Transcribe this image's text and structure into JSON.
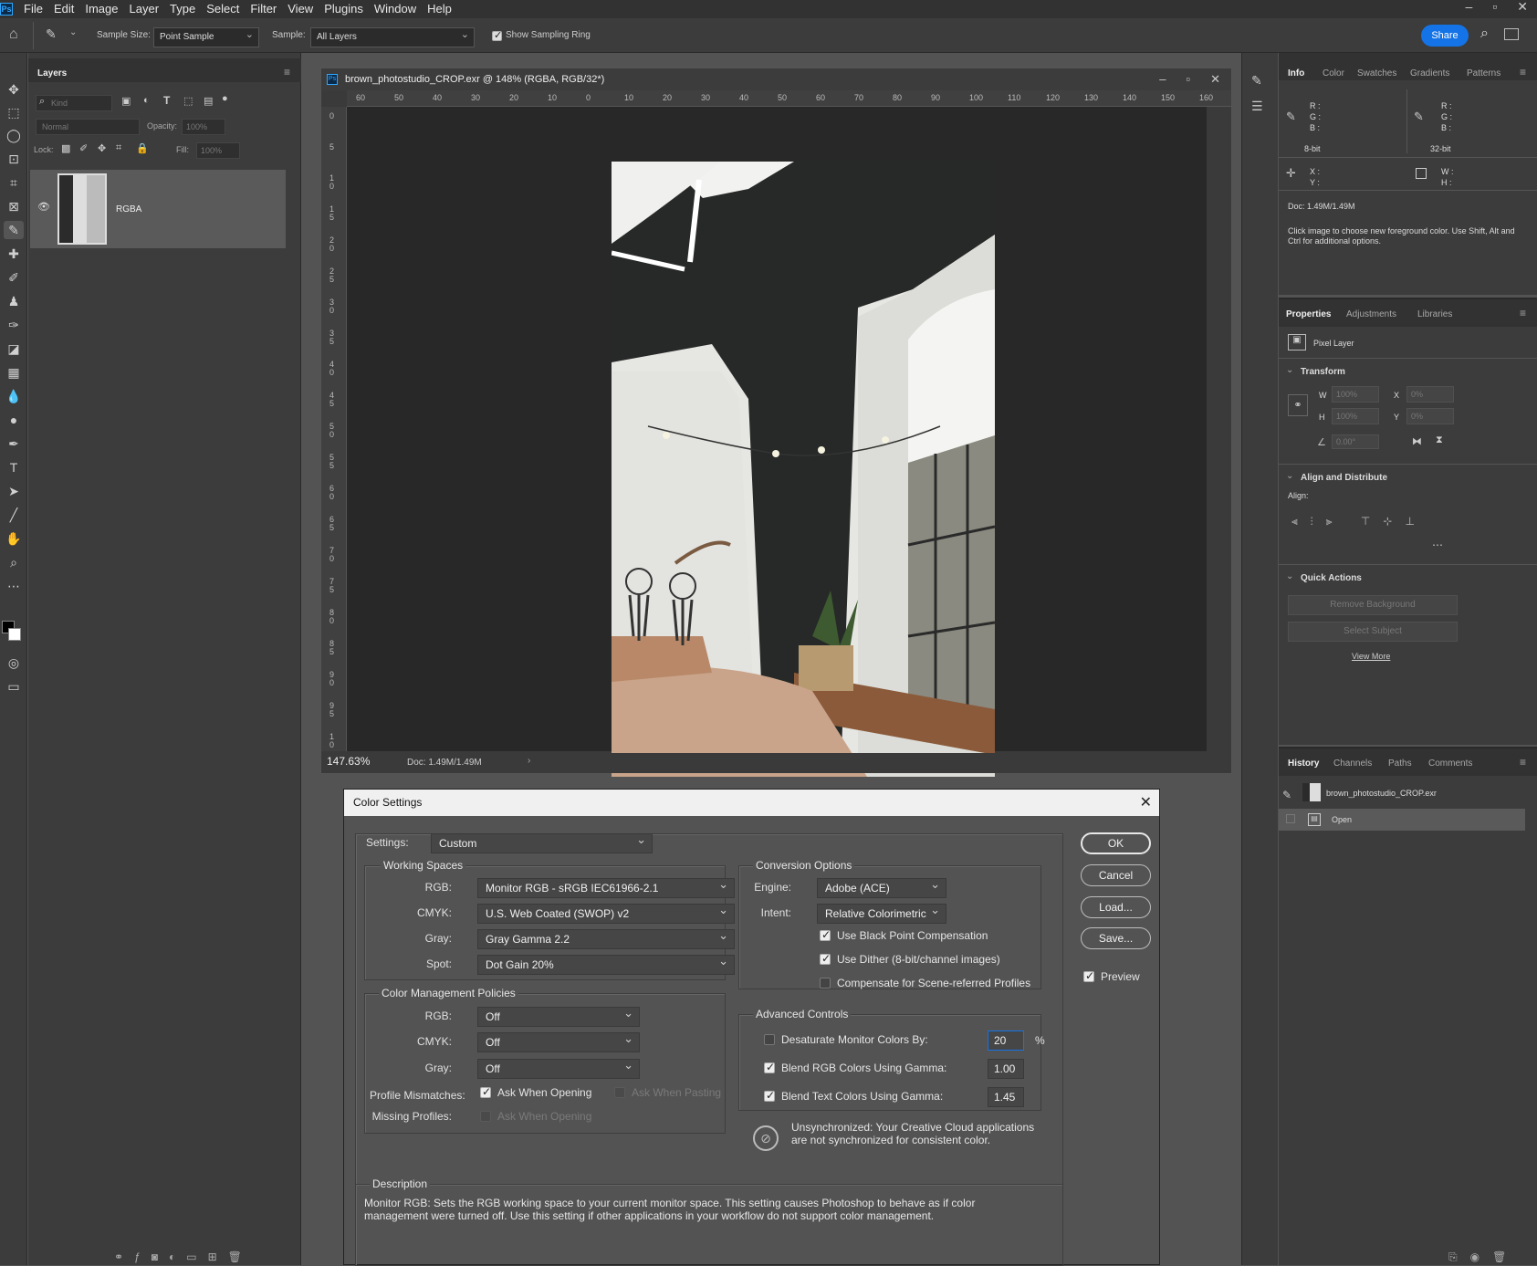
{
  "app": {
    "logo": "Ps"
  },
  "menu": [
    "File",
    "Edit",
    "Image",
    "Layer",
    "Type",
    "Select",
    "Filter",
    "View",
    "Plugins",
    "Window",
    "Help"
  ],
  "options": {
    "sample_size_label": "Sample Size:",
    "sample_size_value": "Point Sample",
    "sample_label": "Sample:",
    "sample_value": "All Layers",
    "show_ring_label": "Show Sampling Ring",
    "share_label": "Share"
  },
  "layers_panel": {
    "tab": "Layers",
    "kind": "Kind",
    "blend": "Normal",
    "opacity_label": "Opacity:",
    "opacity_value": "100%",
    "lock_label": "Lock:",
    "fill_label": "Fill:",
    "fill_value": "100%",
    "layer_name": "RGBA"
  },
  "document": {
    "title": "brown_photostudio_CROP.exr @ 148% (RGBA, RGB/32*)",
    "zoom": "147.63%",
    "doc_size": "Doc: 1.49M/1.49M",
    "h_ticks": [
      "60",
      "50",
      "40",
      "30",
      "20",
      "10",
      "0",
      "10",
      "20",
      "30",
      "40",
      "50",
      "60",
      "70",
      "80",
      "90",
      "100",
      "110",
      "120",
      "130",
      "140",
      "150",
      "160"
    ],
    "v_ticks": [
      "0",
      "5",
      "1 0",
      "1 5",
      "2 0",
      "2 5",
      "3 0",
      "3 5",
      "4 0",
      "4 5",
      "5 0",
      "5 5",
      "6 0",
      "6 5",
      "7 0",
      "7 5",
      "8 0",
      "8 5",
      "9 0",
      "9 5",
      "1 0"
    ]
  },
  "info_panel": {
    "tabs": [
      "Info",
      "Color",
      "Swatches",
      "Gradients",
      "Patterns"
    ],
    "rgb_labels": "R :\nG :\nB :",
    "bit8": "8-bit",
    "bit32": "32-bit",
    "xy": "X :\nY :",
    "wh": "W :\nH :",
    "doc": "Doc: 1.49M/1.49M",
    "hint": "Click image to choose new foreground color.  Use Shift, Alt and Ctrl for additional options."
  },
  "properties_panel": {
    "tabs": [
      "Properties",
      "Adjustments",
      "Libraries"
    ],
    "pixel_layer": "Pixel Layer",
    "transform": "Transform",
    "w_label": "W",
    "w_value": "100%",
    "x_label": "X",
    "x_value": "0%",
    "h_label": "H",
    "h_value": "100%",
    "y_label": "Y",
    "y_value": "0%",
    "angle_value": "0.00°",
    "align_title": "Align and Distribute",
    "align_label": "Align:",
    "quick_title": "Quick Actions",
    "remove_bg": "Remove Background",
    "select_subject": "Select Subject",
    "view_more": "View More"
  },
  "history_panel": {
    "tabs": [
      "History",
      "Channels",
      "Paths",
      "Comments"
    ],
    "snapshot": "brown_photostudio_CROP.exr",
    "step": "Open"
  },
  "dialog": {
    "title": "Color Settings",
    "settings_label": "Settings:",
    "settings_value": "Custom",
    "working_spaces": "Working Spaces",
    "rgb_label": "RGB:",
    "rgb_value": "Monitor RGB - sRGB IEC61966-2.1",
    "cmyk_label": "CMYK:",
    "cmyk_value": "U.S. Web Coated (SWOP) v2",
    "gray_label": "Gray:",
    "gray_value": "Gray Gamma 2.2",
    "spot_label": "Spot:",
    "spot_value": "Dot Gain 20%",
    "policies": "Color Management Policies",
    "p_rgb_label": "RGB:",
    "p_rgb_value": "Off",
    "p_cmyk_label": "CMYK:",
    "p_cmyk_value": "Off",
    "p_gray_label": "Gray:",
    "p_gray_value": "Off",
    "mismatch_label": "Profile Mismatches:",
    "ask_opening": "Ask When Opening",
    "ask_pasting": "Ask When Pasting",
    "missing_label": "Missing Profiles:",
    "missing_ask": "Ask When Opening",
    "conversion": "Conversion Options",
    "engine_label": "Engine:",
    "engine_value": "Adobe (ACE)",
    "intent_label": "Intent:",
    "intent_value": "Relative Colorimetric",
    "bpc": "Use Black Point Compensation",
    "dither": "Use Dither (8-bit/channel images)",
    "scene": "Compensate for Scene-referred Profiles",
    "advanced": "Advanced Controls",
    "desaturate": "Desaturate Monitor Colors By:",
    "desat_value": "20",
    "percent": "%",
    "blend_rgb": "Blend RGB Colors Using Gamma:",
    "blend_rgb_value": "1.00",
    "blend_text": "Blend Text Colors Using Gamma:",
    "blend_text_value": "1.45",
    "unsync": "Unsynchronized: Your Creative Cloud applications are not synchronized for consistent color.",
    "desc_title": "Description",
    "desc_text": "Monitor RGB:  Sets the RGB working space to your current monitor space.  This setting causes Photoshop to behave as if color management were turned off.  Use this setting if other applications in your workflow do not support color management.",
    "ok": "OK",
    "cancel": "Cancel",
    "load": "Load...",
    "save": "Save...",
    "preview": "Preview"
  }
}
